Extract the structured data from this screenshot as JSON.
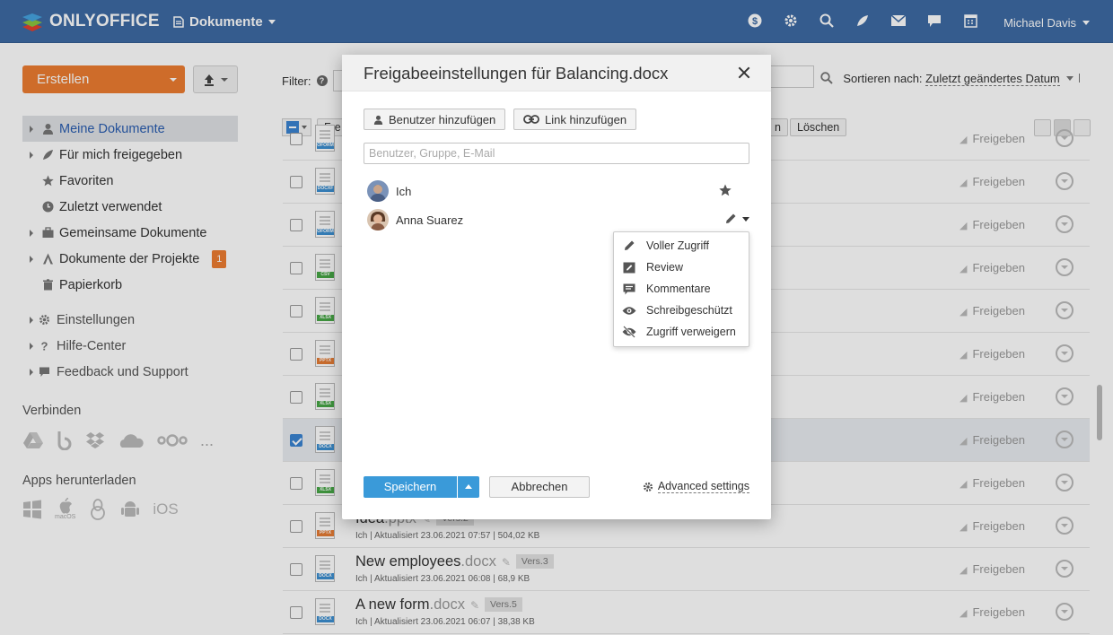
{
  "topbar": {
    "logo": "ONLYOFFICE",
    "section": "Dokumente",
    "user": "Michael Davis",
    "icons": [
      "dollar-icon",
      "gear-icon",
      "search-icon",
      "feed-icon",
      "mail-icon",
      "chat-icon",
      "calendar-icon"
    ]
  },
  "sidebar": {
    "create_label": "Erstellen",
    "items": [
      {
        "label": "Meine Dokumente"
      },
      {
        "label": "Für mich freigegeben"
      },
      {
        "label": "Favoriten"
      },
      {
        "label": "Zuletzt verwendet"
      },
      {
        "label": "Gemeinsame Dokumente"
      },
      {
        "label": "Dokumente der Projekte",
        "badge": "1"
      },
      {
        "label": "Papierkorb"
      }
    ],
    "secondary": [
      {
        "label": "Einstellungen"
      },
      {
        "label": "Hilfe-Center"
      },
      {
        "label": "Feedback und Support"
      }
    ],
    "connect_label": "Verbinden",
    "apps_label": "Apps herunterladen",
    "macos_label": "macOS",
    "ios_label": "iOS",
    "more": "..."
  },
  "main": {
    "filter_label": "Filter:",
    "sort_label": "Sortieren nach:",
    "sort_value": "Zuletzt geändertes Datum",
    "action_first": "Fre",
    "action_delete": "Löschen",
    "action_partial": "n",
    "share_label": "Freigeben",
    "rows": [
      {
        "tag": "OFORM",
        "tagcolor": "#3c8fd0"
      },
      {
        "tag": "DOCXF",
        "tagcolor": "#3c8fd0"
      },
      {
        "tag": "OFORM",
        "tagcolor": "#3c8fd0"
      },
      {
        "tag": "CSV",
        "tagcolor": "#47a646"
      },
      {
        "tag": "XLSX",
        "tagcolor": "#47a646"
      },
      {
        "tag": "PPTX",
        "tagcolor": "#e57b34"
      },
      {
        "tag": "XLSX",
        "tagcolor": "#47a646"
      },
      {
        "tag": "DOCX",
        "tagcolor": "#3c8fd0",
        "selected": true
      },
      {
        "tag": "XLSX",
        "tagcolor": "#47a646"
      },
      {
        "tag": "PPTX",
        "tagcolor": "#e57b34",
        "name": "Idea",
        "ext": ".pptx",
        "version": "Vers.2",
        "meta": "Ich | Aktualisiert 23.06.2021 07:57 | 504,02 KB"
      },
      {
        "tag": "DOCX",
        "tagcolor": "#3c8fd0",
        "name": "New employees",
        "ext": ".docx",
        "version": "Vers.3",
        "meta": "Ich | Aktualisiert 23.06.2021 06:08 | 68,9 KB"
      },
      {
        "tag": "DOCX",
        "tagcolor": "#3c8fd0",
        "name": "A new form",
        "ext": ".docx",
        "version": "Vers.5",
        "meta": "Ich | Aktualisiert 23.06.2021 06:07 | 38,38 KB"
      }
    ]
  },
  "dialog": {
    "title": "Freigabeeinstellungen für Balancing.docx",
    "add_user": "Benutzer hinzufügen",
    "add_link": "Link hinzufügen",
    "search_placeholder": "Benutzer, Gruppe, E-Mail",
    "users": [
      {
        "name": "Ich",
        "role_icon": "star-icon"
      },
      {
        "name": "Anna Suarez",
        "role_icon": "pencil-icon"
      }
    ],
    "save": "Speichern",
    "cancel": "Abbrechen",
    "advanced": "Advanced settings"
  },
  "rights_menu": [
    {
      "label": "Voller Zugriff",
      "icon": "pencil-icon"
    },
    {
      "label": "Review",
      "icon": "review-icon"
    },
    {
      "label": "Kommentare",
      "icon": "comment-icon"
    },
    {
      "label": "Schreibgeschützt",
      "icon": "eye-icon"
    },
    {
      "label": "Zugriff verweigern",
      "icon": "eye-off-icon"
    }
  ],
  "colors": {
    "topbar": "#3d6aa4",
    "accent_orange": "#ed7d31",
    "accent_blue": "#3a9ad9"
  }
}
